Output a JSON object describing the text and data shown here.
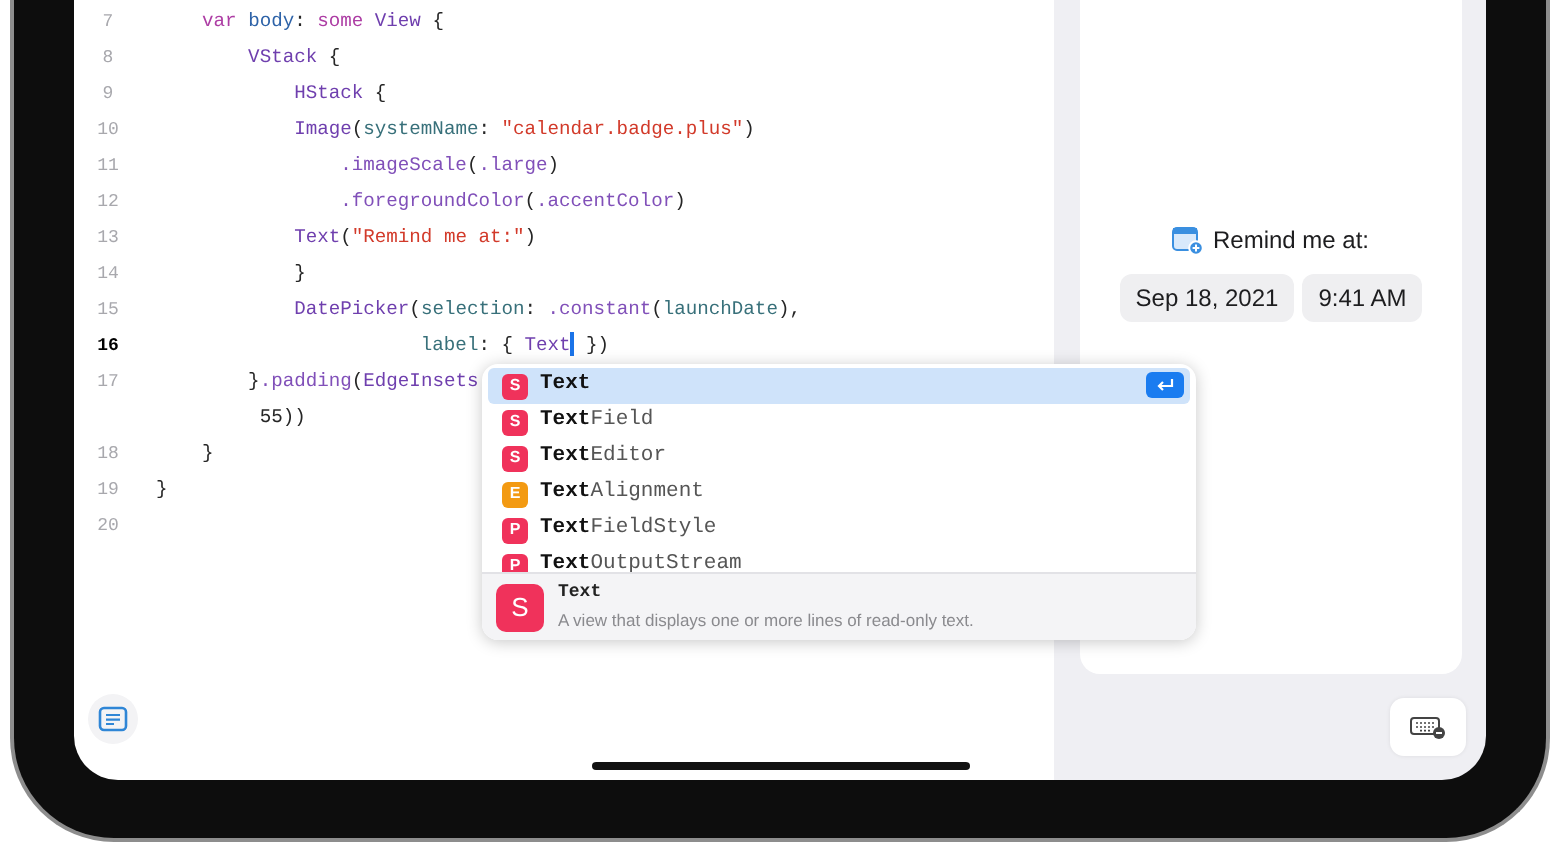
{
  "editor": {
    "lines": [
      {
        "number": "7",
        "current": false,
        "tokens": [
          {
            "text": "    var ",
            "kind": "keyword"
          },
          {
            "text": "body",
            "kind": "decl"
          },
          {
            "text": ": ",
            "kind": "plain"
          },
          {
            "text": "some ",
            "kind": "keyword"
          },
          {
            "text": "View",
            "kind": "type"
          },
          {
            "text": " {",
            "kind": "plain"
          }
        ]
      },
      {
        "number": "8",
        "current": false,
        "tokens": [
          {
            "text": "        VStack",
            "kind": "type"
          },
          {
            "text": " {",
            "kind": "plain"
          }
        ]
      },
      {
        "number": "9",
        "current": false,
        "tokens": [
          {
            "text": "            HStack",
            "kind": "type"
          },
          {
            "text": " {",
            "kind": "plain"
          }
        ]
      },
      {
        "number": "10",
        "current": false,
        "tokens": [
          {
            "text": "            Image",
            "kind": "type"
          },
          {
            "text": "(",
            "kind": "plain"
          },
          {
            "text": "systemName",
            "kind": "param"
          },
          {
            "text": ": ",
            "kind": "plain"
          },
          {
            "text": "\"calendar.badge.plus\"",
            "kind": "string"
          },
          {
            "text": ")",
            "kind": "plain"
          }
        ]
      },
      {
        "number": "11",
        "current": false,
        "tokens": [
          {
            "text": "                .imageScale",
            "kind": "member"
          },
          {
            "text": "(",
            "kind": "plain"
          },
          {
            "text": ".large",
            "kind": "member"
          },
          {
            "text": ")",
            "kind": "plain"
          }
        ]
      },
      {
        "number": "12",
        "current": false,
        "tokens": [
          {
            "text": "                .foregroundColor",
            "kind": "member"
          },
          {
            "text": "(",
            "kind": "plain"
          },
          {
            "text": ".accentColor",
            "kind": "member"
          },
          {
            "text": ")",
            "kind": "plain"
          }
        ]
      },
      {
        "number": "13",
        "current": false,
        "tokens": [
          {
            "text": "            Text",
            "kind": "type"
          },
          {
            "text": "(",
            "kind": "plain"
          },
          {
            "text": "\"Remind me at:\"",
            "kind": "string"
          },
          {
            "text": ")",
            "kind": "plain"
          }
        ]
      },
      {
        "number": "14",
        "current": false,
        "tokens": [
          {
            "text": "            }",
            "kind": "plain"
          }
        ]
      },
      {
        "number": "15",
        "current": false,
        "tokens": [
          {
            "text": "            DatePicker",
            "kind": "type"
          },
          {
            "text": "(",
            "kind": "plain"
          },
          {
            "text": "selection",
            "kind": "param"
          },
          {
            "text": ": ",
            "kind": "plain"
          },
          {
            "text": ".constant",
            "kind": "member"
          },
          {
            "text": "(",
            "kind": "plain"
          },
          {
            "text": "launchDate",
            "kind": "param"
          },
          {
            "text": "),",
            "kind": "plain"
          }
        ]
      },
      {
        "number": "16",
        "current": true,
        "tokens": [
          {
            "text": "                       label",
            "kind": "param"
          },
          {
            "text": ": { ",
            "kind": "plain"
          },
          {
            "text": "Text",
            "kind": "type"
          },
          {
            "kind": "caret"
          },
          {
            "text": " })",
            "kind": "plain"
          }
        ]
      },
      {
        "number": "17",
        "current": false,
        "tokens": [
          {
            "text": "        }",
            "kind": "plain"
          },
          {
            "text": ".padding",
            "kind": "member"
          },
          {
            "text": "(",
            "kind": "plain"
          },
          {
            "text": "EdgeInsets",
            "kind": "type"
          }
        ]
      },
      {
        "tokens": [
          {
            "text": "         55))",
            "kind": "plain"
          }
        ]
      },
      {
        "number": "18",
        "current": false,
        "tokens": [
          {
            "text": "    }",
            "kind": "plain"
          }
        ]
      },
      {
        "number": "19",
        "current": false,
        "tokens": [
          {
            "text": "}",
            "kind": "plain"
          }
        ]
      },
      {
        "number": "20",
        "current": false
      }
    ]
  },
  "completions": {
    "items": [
      {
        "badge": "S",
        "color": "#f0325b",
        "label": "**Text**",
        "selected": true
      },
      {
        "badge": "S",
        "color": "#f0325b",
        "label": "**Text**Field",
        "selected": false
      },
      {
        "badge": "S",
        "color": "#f0325b",
        "label": "**Text**Editor",
        "selected": false
      },
      {
        "badge": "E",
        "color": "#f39a12",
        "label": "**Text**Alignment",
        "selected": false
      },
      {
        "badge": "P",
        "color": "#f0325b",
        "label": "**Text**FieldStyle",
        "selected": false
      },
      {
        "badge": "P",
        "color": "#f0325b",
        "label": "**Text**OutputStream",
        "selected": false
      }
    ],
    "detail": {
      "badge": "S",
      "color": "#f0325b",
      "title": "Text",
      "description": "A view that displays one or more lines of read-only text."
    }
  },
  "preview": {
    "label": "Remind me at:",
    "date": "Sep 18, 2021",
    "time": "9:41 AM"
  }
}
